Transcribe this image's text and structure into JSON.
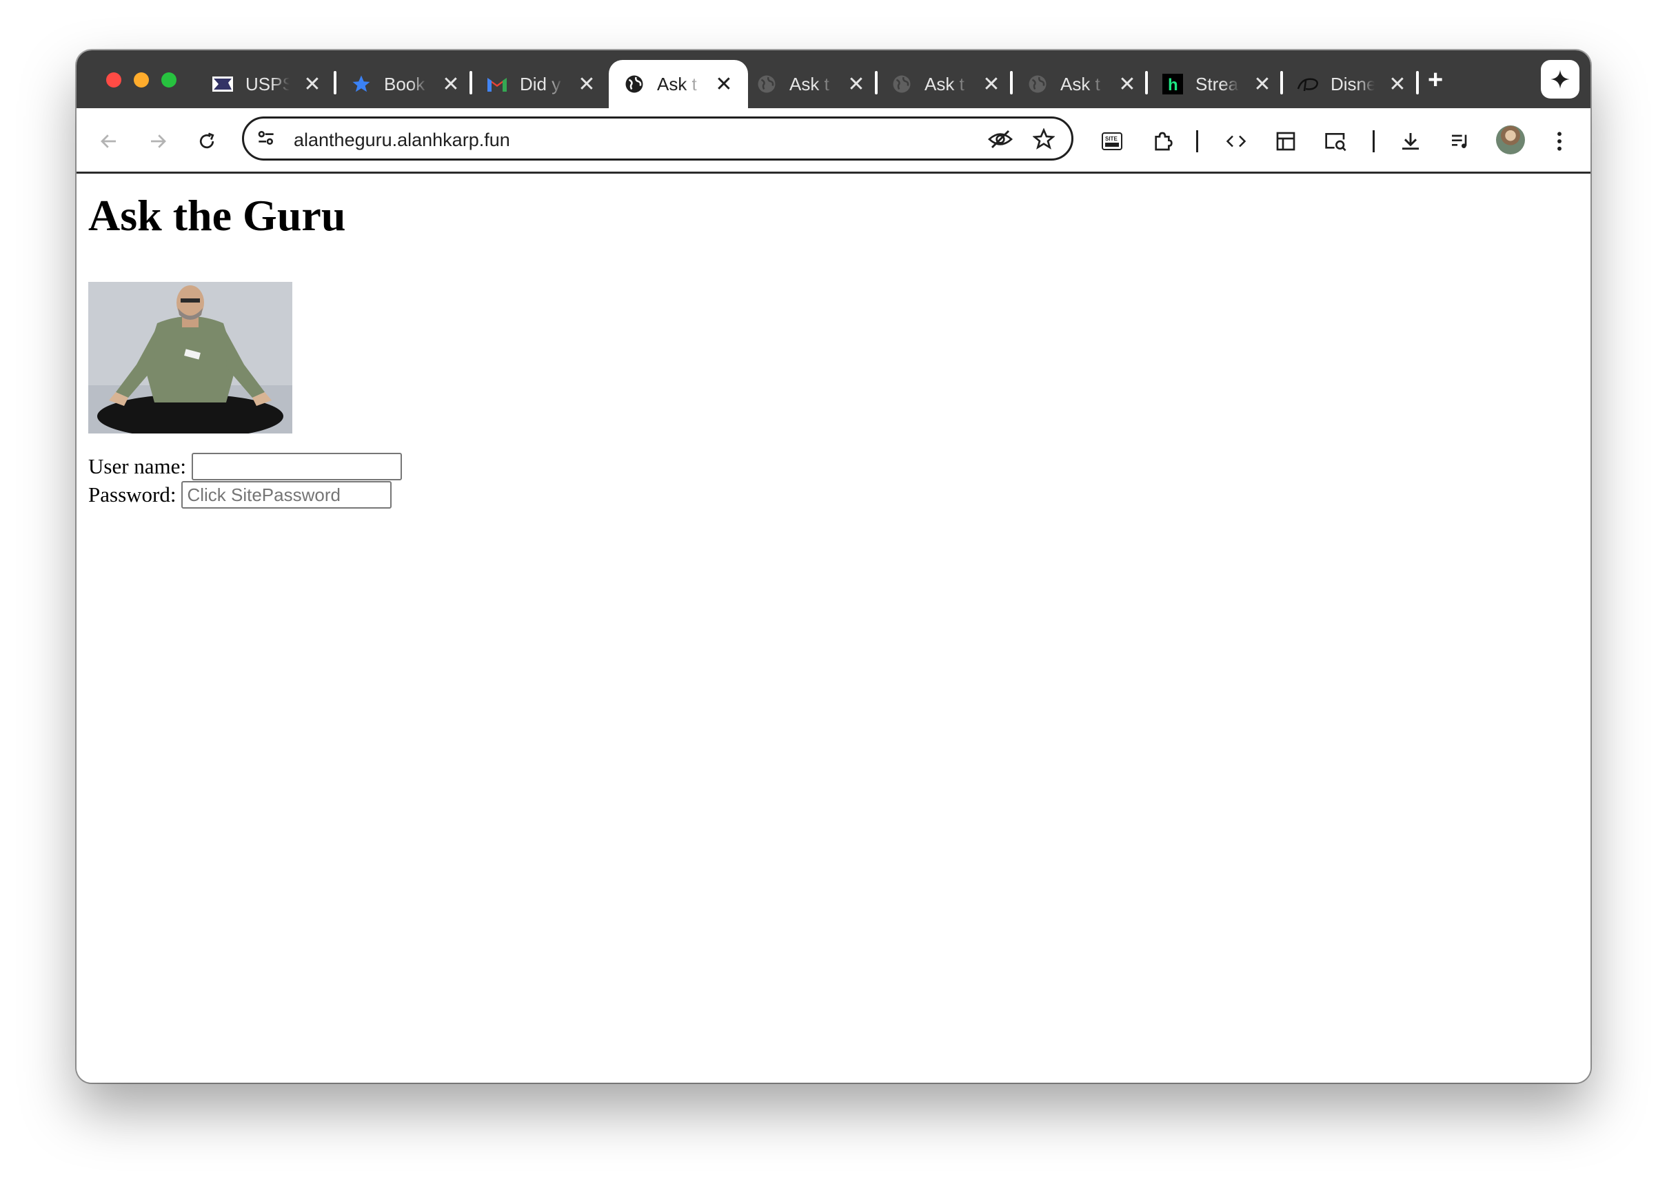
{
  "browser": {
    "tabs": [
      {
        "label": "USPS",
        "icon": "usps-eagle-icon",
        "active": false
      },
      {
        "label": "Book",
        "icon": "star-bookmark-icon",
        "active": false
      },
      {
        "label": "Did y",
        "icon": "gmail-icon",
        "active": false
      },
      {
        "label": "Ask t",
        "icon": "globe-icon",
        "active": true
      },
      {
        "label": "Ask t",
        "icon": "globe-icon",
        "active": false
      },
      {
        "label": "Ask t",
        "icon": "globe-icon",
        "active": false
      },
      {
        "label": "Ask t",
        "icon": "globe-icon",
        "active": false
      },
      {
        "label": "Strea",
        "icon": "h-logo-icon",
        "active": false
      },
      {
        "label": "Disne",
        "icon": "disney-logo-icon",
        "active": false
      }
    ],
    "new_tab_label": "+",
    "url": "alantheguru.alanhkarp.fun",
    "colors": {
      "tabstrip_bg": "#3c3c3c",
      "active_tab_bg": "#ffffff",
      "close_dot": "#ff4b45",
      "min_dot": "#ffac2c",
      "max_dot": "#27c23f"
    }
  },
  "page": {
    "title": "Ask the Guru",
    "form": {
      "username_label": "User name:",
      "username_value": "",
      "password_label": "Password:",
      "password_placeholder": "Click SitePassword"
    }
  }
}
